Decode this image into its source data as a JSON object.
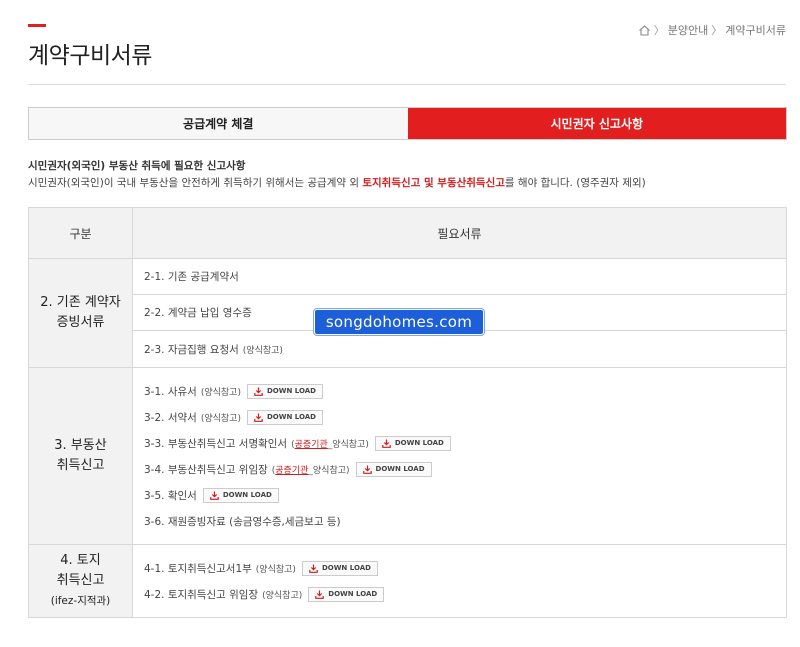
{
  "page": {
    "title": "계약구비서류"
  },
  "breadcrumb": {
    "items": [
      "분양안내",
      "계약구비서류"
    ],
    "separator": "〉"
  },
  "tabs": [
    {
      "label": "공급계약 체결",
      "active": false
    },
    {
      "label": "시민권자 신고사항",
      "active": true
    }
  ],
  "intro": {
    "heading": "시민권자(외국인) 부동산 취득에 필요한 신고사항",
    "line_pre": "시민권자(외국인)이 국내 부동산을 안전하게 취득하기 위해서는 공급계약 외 ",
    "line_hl": "토지취득신고 및 부동산취득신고",
    "line_post": "를 해야 합니다. (영주권자 제외)"
  },
  "table": {
    "headers": [
      "구분",
      "필요서류"
    ],
    "groups": [
      {
        "category_line1": "2. 기존 계약자",
        "category_line2": "증빙서류",
        "items": [
          {
            "text": "2-1. 기존 공급계약서"
          },
          {
            "text": "2-2. 계약금 납입 영수증"
          },
          {
            "text": "2-3. 자금집행 요청서",
            "note": "(양식참고)"
          }
        ]
      },
      {
        "category_line1": "3. 부동산",
        "category_line2": "취득신고",
        "items": [
          {
            "text": "3-1. 사유서",
            "note": "(양식참고)",
            "download": "DOWN LOAD"
          },
          {
            "text": "3-2. 서약서",
            "note": "(양식참고)",
            "download": "DOWN LOAD"
          },
          {
            "text": "3-3. 부동산취득신고 서명확인서",
            "note_pre": "(",
            "note_red": "공증기관",
            "note_post": "_양식참고)",
            "download": "DOWN LOAD"
          },
          {
            "text": "3-4. 부동산취득신고 위임장",
            "note_pre": "(",
            "note_red": "공증기관",
            "note_post": "_양식참고)",
            "download": "DOWN LOAD"
          },
          {
            "text": "3-5. 확인서",
            "download": "DOWN LOAD"
          },
          {
            "text": "3-6. 재원증빙자료 (송금영수증,세금보고 등)"
          }
        ]
      },
      {
        "category_line1": "4. 토지",
        "category_line2": "취득신고",
        "category_line3": "(ifez-지적과)",
        "items": [
          {
            "text": "4-1. 토지취득신고서1부",
            "note": "(양식참고)",
            "download": "DOWN LOAD"
          },
          {
            "text": "4-2. 토지취득신고 위임장",
            "note": "(양식참고)",
            "download": "DOWN LOAD"
          }
        ]
      }
    ]
  },
  "watermark": "songdohomes.com",
  "colors": {
    "accent": "#e31e1e",
    "watermark_bg": "#1d5fd8"
  },
  "icons": [
    "home-icon",
    "download-icon"
  ]
}
